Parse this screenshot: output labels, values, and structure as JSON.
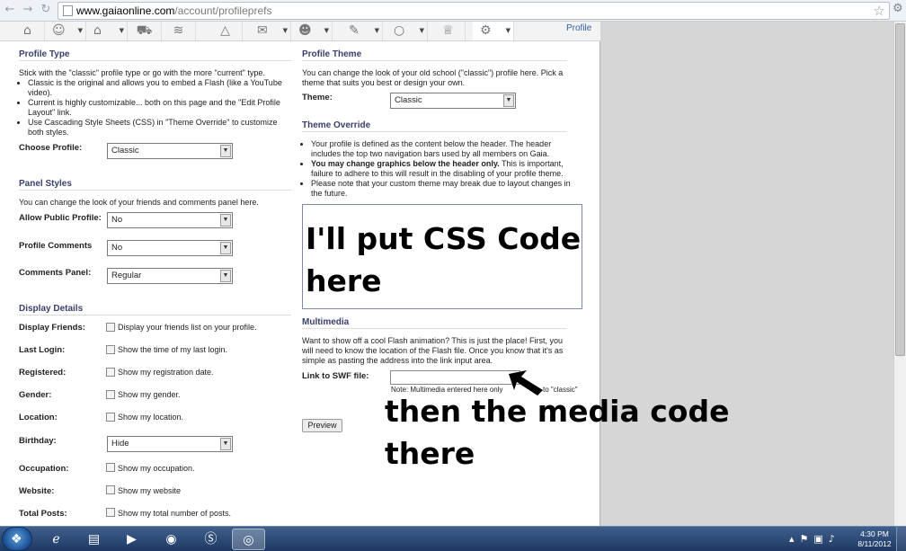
{
  "browser": {
    "url_host": "www.gaiaonline.com",
    "url_path": "/account/profileprefs"
  },
  "nav": {
    "profile_link": "Profile"
  },
  "profile_type": {
    "title": "Profile Type",
    "intro": "Stick with the \"classic\" profile type or go with the more \"current\" type.",
    "bullets": [
      "Classic is the original and allows you to embed a Flash (like a YouTube video).",
      "Current is highly customizable... both on this page and the \"Edit Profile Layout\" link.",
      "Use Cascading Style Sheets (CSS) in \"Theme Override\" to customize both styles."
    ],
    "choose_label": "Choose Profile:",
    "choose_value": "Classic"
  },
  "panel_styles": {
    "title": "Panel Styles",
    "intro": "You can change the look of your friends and comments panel here.",
    "public_label": "Allow Public Profile:",
    "public_value": "No",
    "comments_label": "Profile Comments",
    "comments_value": "No",
    "panel_label": "Comments Panel:",
    "panel_value": "Regular"
  },
  "display_details": {
    "title": "Display Details",
    "rows": [
      {
        "label": "Display Friends:",
        "option": "Display your friends list on your profile."
      },
      {
        "label": "Last Login:",
        "option": "Show the time of my last login."
      },
      {
        "label": "Registered:",
        "option": "Show my registration date."
      },
      {
        "label": "Gender:",
        "option": "Show my gender."
      },
      {
        "label": "Location:",
        "option": "Show my location."
      },
      {
        "label": "Birthday:",
        "option": "Hide"
      },
      {
        "label": "Occupation:",
        "option": "Show my occupation."
      },
      {
        "label": "Website:",
        "option": "Show my website"
      },
      {
        "label": "Total Posts:",
        "option": "Show my total number of posts."
      }
    ]
  },
  "profile_theme": {
    "title": "Profile Theme",
    "intro": "You can change the look of your old school (\"classic\") profile here. Pick a theme that suits you best or design your own.",
    "theme_label": "Theme:",
    "theme_value": "Classic"
  },
  "theme_override": {
    "title": "Theme Override",
    "bullet1": "Your profile is defined as the content below the header. The header includes the top two navigation bars used by all members on Gaia.",
    "bullet2_bold": "You may change graphics below the header only.",
    "bullet2_rest": " This is important, failure to adhere to this will result in the disabling of your profile theme.",
    "bullet3": "Please note that your custom theme may break due to layout changes in the future.",
    "textarea_value": "I'll put CSS Code here"
  },
  "multimedia": {
    "title": "Multimedia",
    "intro": "Want to show off a cool Flash animation? This is just the place! First, you will need to know the location of the Flash file. Once you know that it's as simple as pasting the address into the link input area.",
    "swf_label": "Link to SWF file:",
    "note_left": "Note: Multimedia entered here only",
    "note_right": "to \"classic\"",
    "preview_label": "Preview"
  },
  "annotation": {
    "text": "then the media code there"
  },
  "taskbar": {
    "time": "4:30 PM",
    "date": "8/11/2012"
  }
}
